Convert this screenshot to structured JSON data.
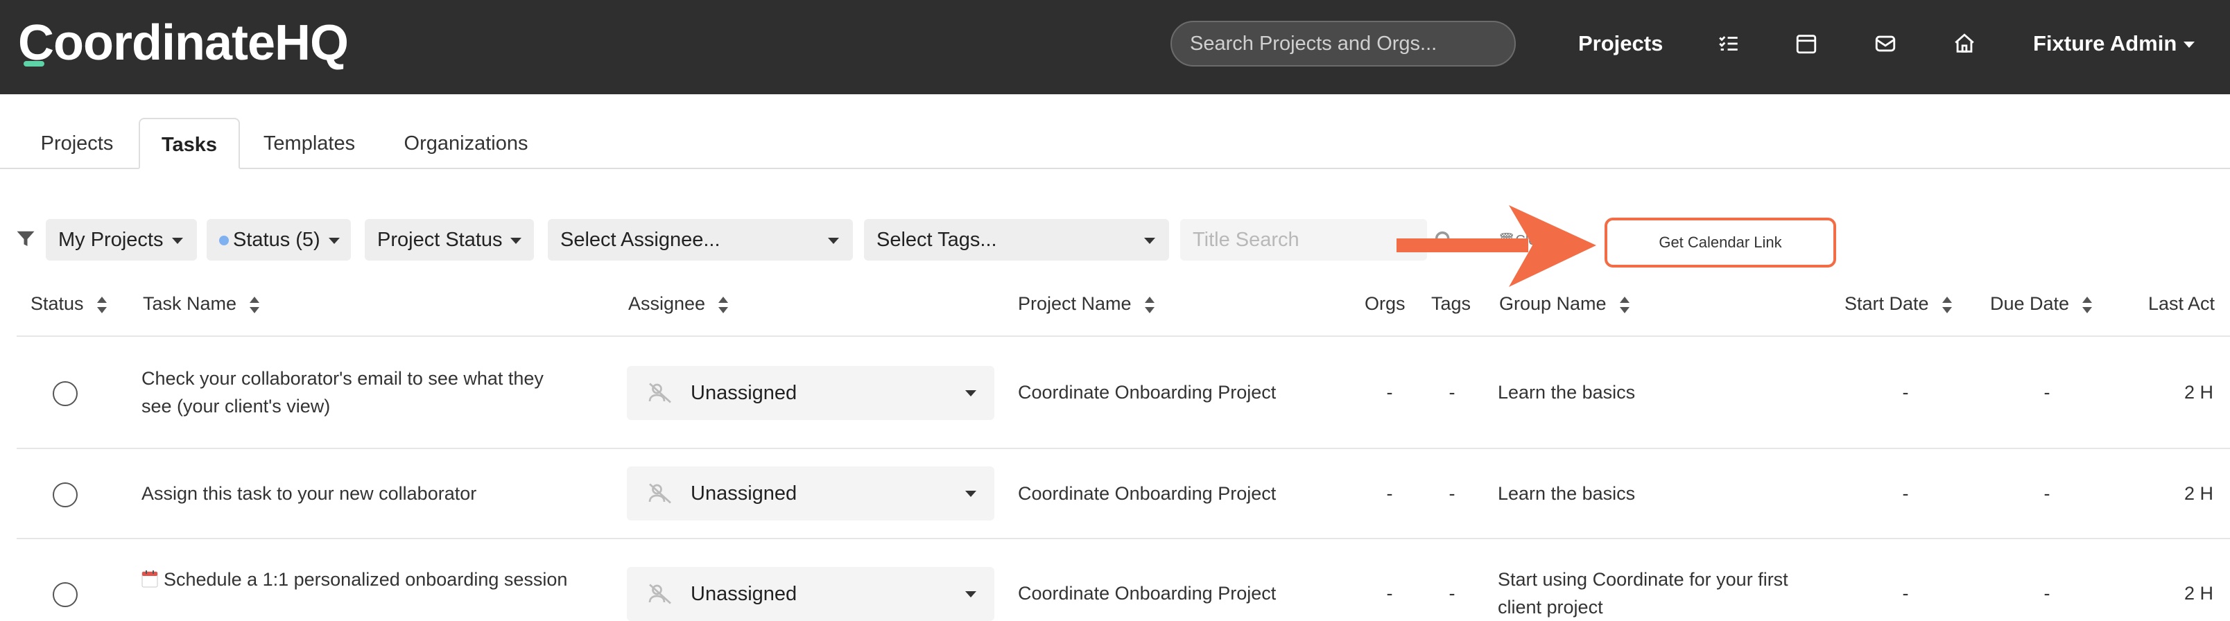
{
  "navbar": {
    "logo": "CoordinateHQ",
    "search_placeholder": "Search Projects and Orgs...",
    "projects_link": "Projects",
    "icons": [
      "tasks-icon",
      "calendar-icon",
      "mail-icon",
      "home-icon"
    ],
    "user_menu": "Fixture Admin",
    "background": "#2f2f2f",
    "logo_accent_color": "#5ed3a8"
  },
  "tabs": [
    {
      "label": "Projects",
      "active": false
    },
    {
      "label": "Tasks",
      "active": true
    },
    {
      "label": "Templates",
      "active": false
    },
    {
      "label": "Organizations",
      "active": false
    }
  ],
  "filters": {
    "my_projects": "My Projects",
    "status": "Status (5)",
    "project_status": "Project Status",
    "assignee_placeholder": "Select Assignee...",
    "tags_placeholder": "Select Tags...",
    "title_search_placeholder": "Title Search",
    "clear_label": "Clear",
    "calendar_link": "Get Calendar Link",
    "highlight_color": "#f26d45"
  },
  "table": {
    "headers": {
      "status": "Status",
      "task_name": "Task Name",
      "assignee": "Assignee",
      "project_name": "Project Name",
      "orgs": "Orgs",
      "tags": "Tags",
      "group_name": "Group Name",
      "start_date": "Start Date",
      "due_date": "Due Date",
      "last_activity": "Last Act"
    },
    "rows": [
      {
        "task_line1": "Check your collaborator's email to see what they",
        "task_line2": "see (your client's view)",
        "assignee": "Unassigned",
        "project": "Coordinate Onboarding Project",
        "orgs": "-",
        "tags": "-",
        "group_line1": "Learn the basics",
        "group_line2": "",
        "start": "-",
        "due": "-",
        "last": "2 H"
      },
      {
        "task_line1": "Assign this task to your new collaborator",
        "task_line2": "",
        "assignee": "Unassigned",
        "project": "Coordinate Onboarding Project",
        "orgs": "-",
        "tags": "-",
        "group_line1": "Learn the basics",
        "group_line2": "",
        "start": "-",
        "due": "-",
        "last": "2 H"
      },
      {
        "task_line1": "Schedule a 1:1 personalized onboarding session",
        "task_line2": "",
        "assignee": "Unassigned",
        "project": "Coordinate Onboarding Project",
        "orgs": "-",
        "tags": "-",
        "group_line1": "Start using Coordinate for your first",
        "group_line2": "client project",
        "start": "-",
        "due": "-",
        "last": "2 H"
      }
    ]
  }
}
